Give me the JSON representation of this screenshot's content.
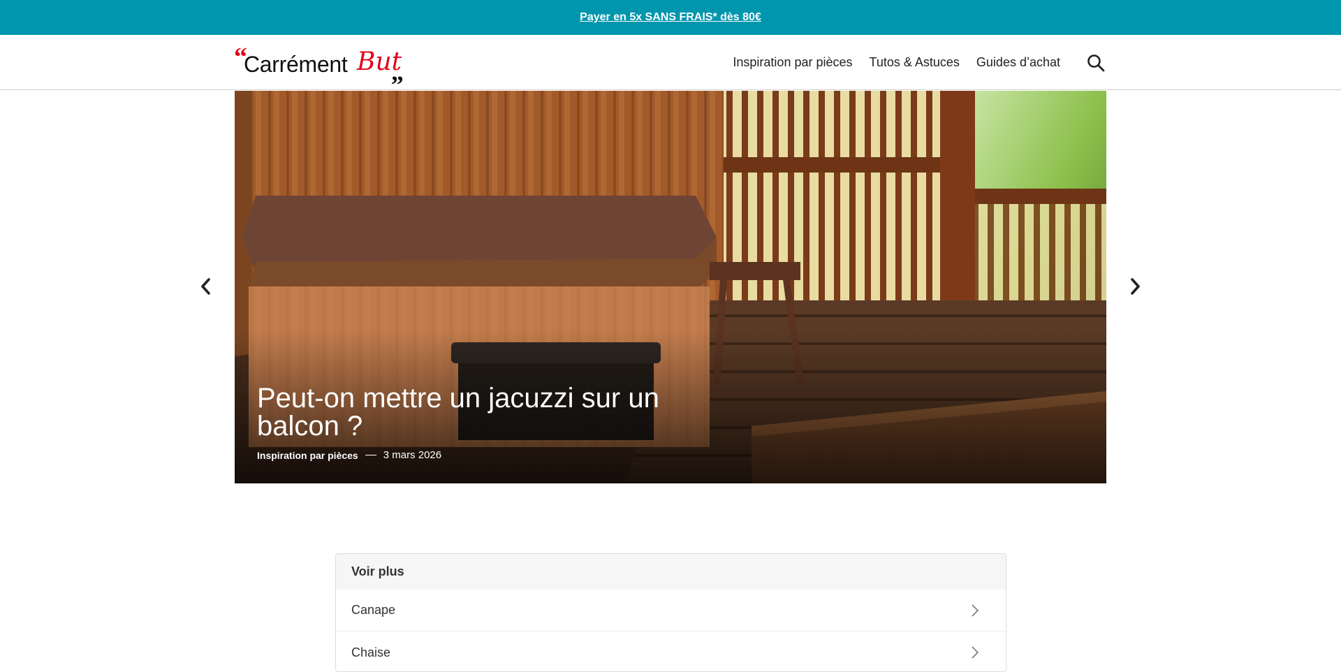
{
  "promo": {
    "text": "Payer en 5x SANS FRAIS* dès 80€"
  },
  "logo": {
    "quote_open": "“",
    "word1": "Carrément",
    "word2": "But",
    "quote_close": "„"
  },
  "nav": {
    "items": [
      "Inspiration par pièces",
      "Tutos & Astuces",
      "Guides d’achat"
    ],
    "search_icon": "search-icon"
  },
  "hero": {
    "title": "Peut-on mettre un jacuzzi sur un balcon ?",
    "category": "Inspiration par pièces",
    "date": "3 mars 2026",
    "prev_icon": "chevron-left-icon",
    "next_icon": "chevron-right-icon"
  },
  "more": {
    "heading": "Voir plus",
    "items": [
      "Canape",
      "Chaise"
    ]
  },
  "colors": {
    "promo_bg": "#0096ad",
    "brand_red": "#e2001a"
  }
}
